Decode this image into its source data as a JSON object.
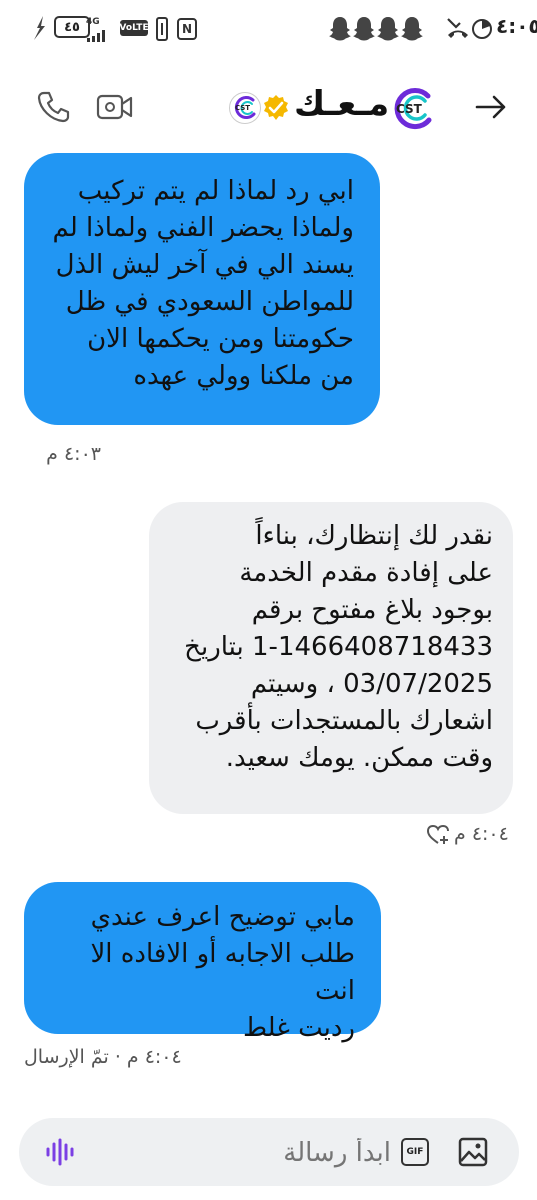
{
  "status_bar": {
    "time": "٤:٠٥",
    "battery": "٤٥",
    "network": "4G",
    "volte": "VoLTE",
    "nfc": "N"
  },
  "header": {
    "contact_name": "مـعـك",
    "logo_text": "CST",
    "badge_logo_text": "CST"
  },
  "messages": [
    {
      "direction": "sent",
      "text": "ابي رد لماذا لم يتم تركيب\nولماذا يحضر الفني ولماذا لم\nيسند الي في آخر ليش الذل\nللمواطن السعودي في ظل\nحكومتنا ومن يحكمها الان\nمن ملكنا وولي عهده",
      "meta": "٤:٠٣ م"
    },
    {
      "direction": "received",
      "text": "نقدر لك إنتظارك، بناءاً\nعلى إفادة مقدم الخدمة\nبوجود  بلاغ مفتوح برقم\n1-1466408718433 بتاريخ\n03/07/2025 ، وسيتم\nاشعارك بالمستجدات بأقرب\nوقت ممكن. يومك سعيد.",
      "meta": "٤:٠٤ م"
    },
    {
      "direction": "sent",
      "text": "مابي توضيح اعرف عندي\nطلب الاجابه أو الافاده الا انت\nرديت غلط",
      "meta": "٤:٠٤ م · تمّ الإرسال"
    }
  ],
  "composer": {
    "placeholder": "ابدأ رسالة",
    "gif_label": "GIF"
  },
  "colors": {
    "sent_bubble": "#2196f3",
    "received_bubble": "#eeeff1",
    "verified_badge": "#f5b800",
    "logo_purple": "#6d2bd9",
    "logo_teal": "#18c5c9"
  }
}
